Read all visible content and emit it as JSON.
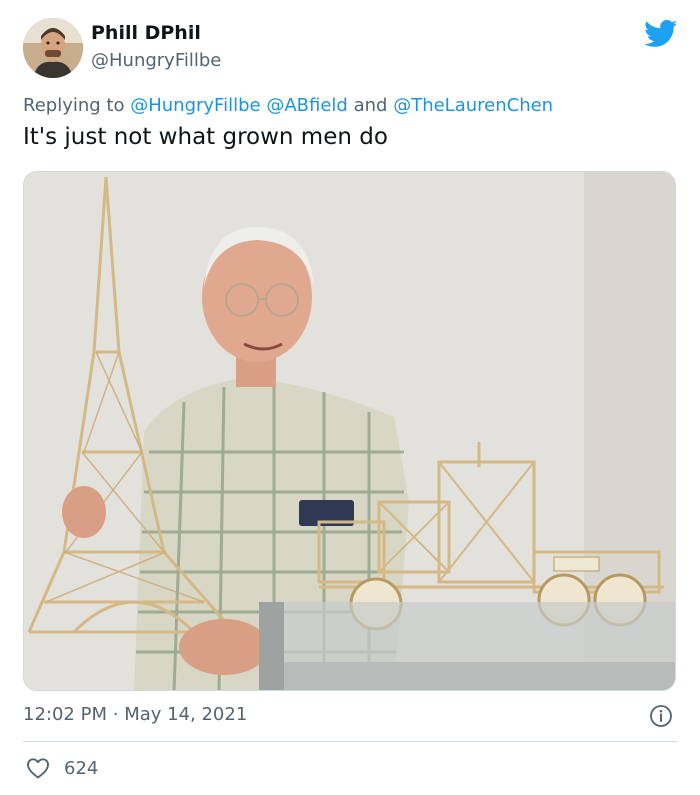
{
  "tweet": {
    "author": {
      "display_name": "Phill DPhil",
      "handle": "@HungryFillbe"
    },
    "reply": {
      "prefix": "Replying to",
      "mentions": [
        "@HungryFillbe",
        "@ABfield",
        "@TheLaurenChen"
      ],
      "conjunction": "and"
    },
    "text": "It's just not what grown men do",
    "time": "12:02 PM",
    "separator": "·",
    "date": "May 14, 2021",
    "likes": "624"
  },
  "colors": {
    "brand": "#1da1f2",
    "mention": "#1b95e0",
    "secondary_text": "#536471",
    "like_icon": "#536471"
  },
  "icons": [
    "twitter-bird-icon",
    "info-icon",
    "heart-icon"
  ]
}
